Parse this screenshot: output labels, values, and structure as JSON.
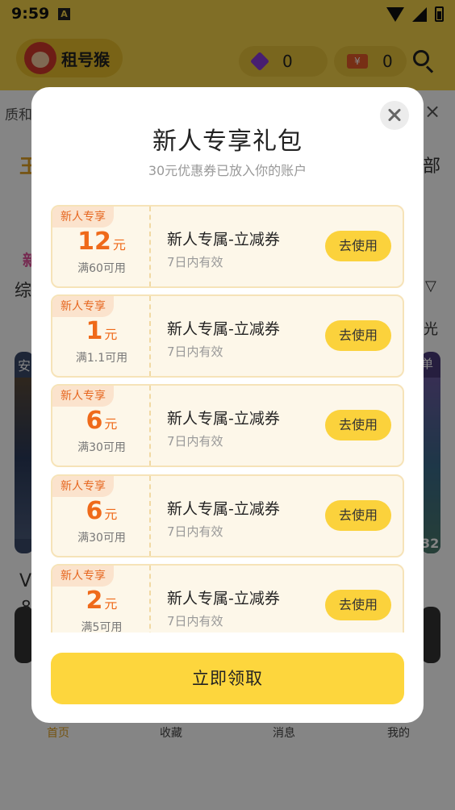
{
  "status_bar": {
    "time": "9:59",
    "notification_letter": "A"
  },
  "app": {
    "logo_text": "租号猴",
    "diamond_count": "0",
    "coupon_symbol": "¥",
    "coupon_count": "0",
    "search_text": "质和",
    "bg_texts": {
      "orange_left": "王",
      "right_all": "部",
      "pink_new": "新",
      "left_cat": "综",
      "right_light": "光",
      "tag_an": "安",
      "tag_dan": "单",
      "num_32": "32",
      "v_text": "V",
      "num_8": "8"
    }
  },
  "tabbar": {
    "tabs": [
      "首页",
      "收藏",
      "消息",
      "我的"
    ]
  },
  "modal": {
    "title": "新人专享礼包",
    "subtitle": "30元优惠券已放入你的账户",
    "claim_label": "立即领取",
    "coupons": [
      {
        "tag": "新人专享",
        "amount": "12",
        "unit": "元",
        "condition": "满60可用",
        "name": "新人专属-立减券",
        "validity": "7日内有效",
        "button": "去使用"
      },
      {
        "tag": "新人专享",
        "amount": "1",
        "unit": "元",
        "condition": "满1.1可用",
        "name": "新人专属-立减券",
        "validity": "7日内有效",
        "button": "去使用"
      },
      {
        "tag": "新人专享",
        "amount": "6",
        "unit": "元",
        "condition": "满30可用",
        "name": "新人专属-立减券",
        "validity": "7日内有效",
        "button": "去使用"
      },
      {
        "tag": "新人专享",
        "amount": "6",
        "unit": "元",
        "condition": "满30可用",
        "name": "新人专属-立减券",
        "validity": "7日内有效",
        "button": "去使用"
      },
      {
        "tag": "新人专享",
        "amount": "2",
        "unit": "元",
        "condition": "满5可用",
        "name": "新人专属-立减券",
        "validity": "7日内有效",
        "button": "去使用"
      }
    ]
  },
  "colors": {
    "brand_yellow": "#f6d34a",
    "accent_orange": "#ef6a1a",
    "button_yellow": "#fbd23c"
  }
}
